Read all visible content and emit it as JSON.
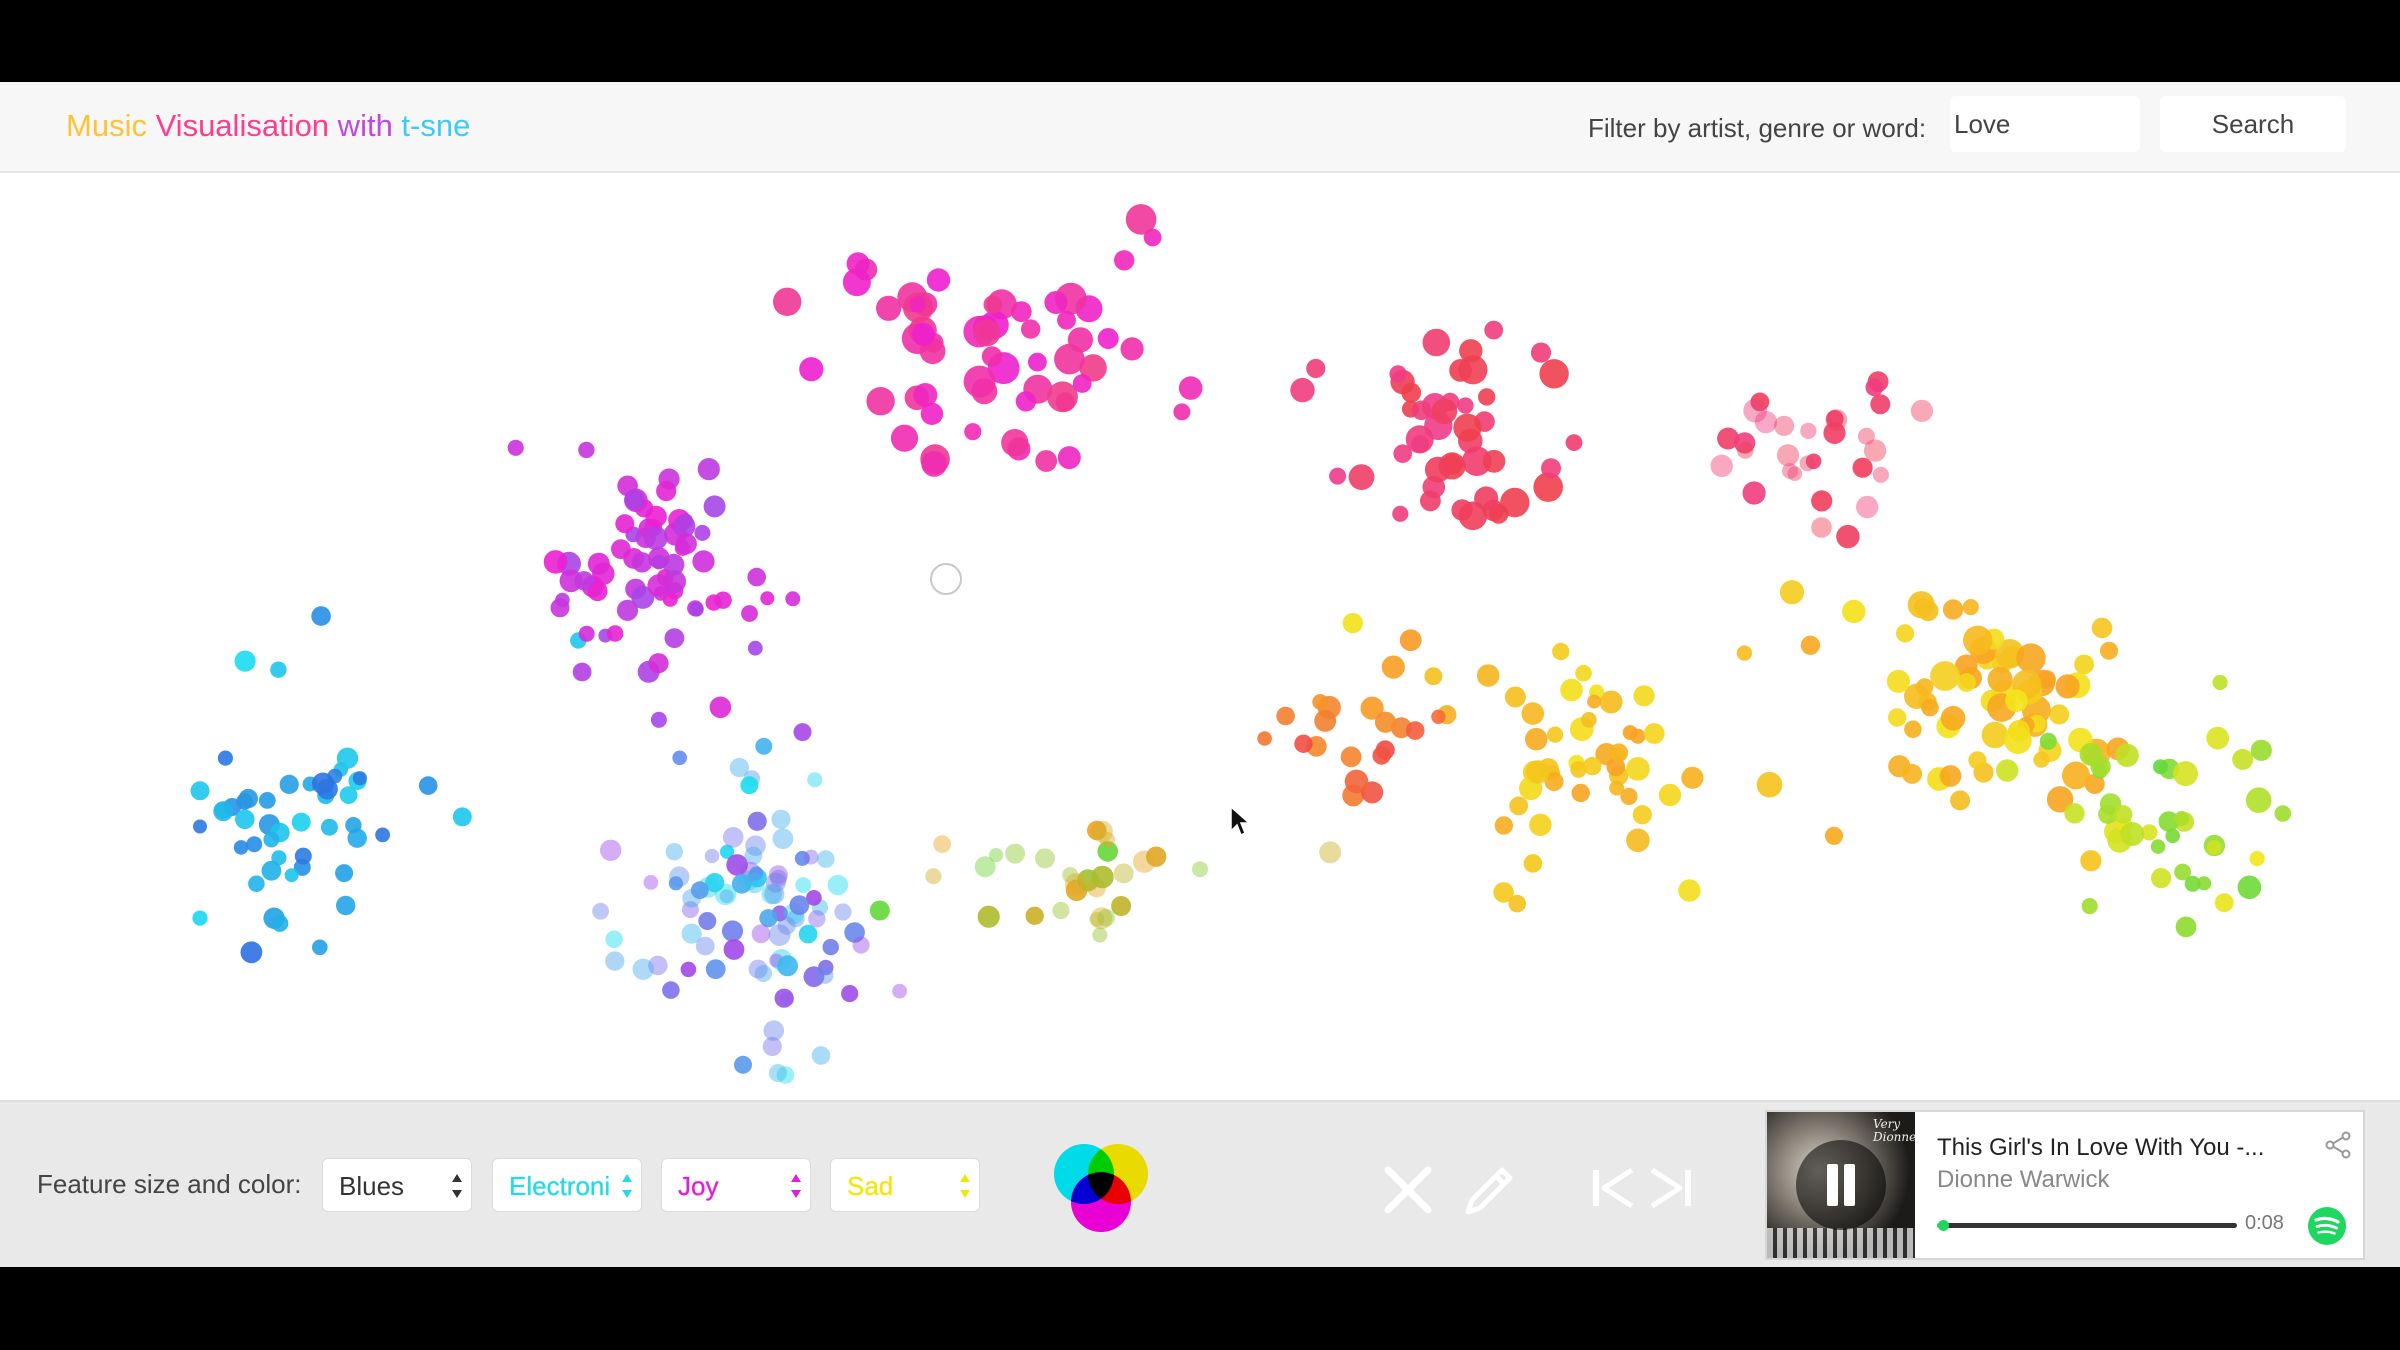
{
  "header": {
    "title_parts": [
      {
        "text": "Music",
        "color": "#ffc233"
      },
      {
        "text": " Visualisation",
        "color": "#ff3c8e"
      },
      {
        "text": " with",
        "color": "#c04ae0"
      },
      {
        "text": " t-sne",
        "color": "#3ccbf5"
      }
    ],
    "filter_label": "Filter by artist, genre or word:",
    "search_value": "Love",
    "search_button": "Search"
  },
  "toolbar": {
    "feature_label": "Feature size and color:",
    "selects": [
      {
        "value": "Blues",
        "color": "#333333"
      },
      {
        "value": "Electroni",
        "color": "#27d8e8"
      },
      {
        "value": "Joy",
        "color": "#e01fd6"
      },
      {
        "value": "Sad",
        "color": "#f1e60c"
      }
    ],
    "icons": [
      "color-wheel-icon",
      "close-icon",
      "pencil-icon",
      "previous-track-icon",
      "next-track-icon"
    ]
  },
  "player": {
    "album_text": "Very Dionne",
    "track_title": "This Girl's In Love With You -...",
    "artist": "Dionne Warwick",
    "elapsed": "0:08",
    "progress": 0.02,
    "accent": "#1ed760"
  },
  "colors": {
    "cyan": "#19e0f0",
    "blue": "#2d6fe0",
    "violet": "#a447e8",
    "magenta": "#ee1fd0",
    "pink": "#f03c8a",
    "red": "#ef3f4b",
    "orange": "#f7a021",
    "yellow": "#f3e51a",
    "green": "#63d83a"
  }
}
